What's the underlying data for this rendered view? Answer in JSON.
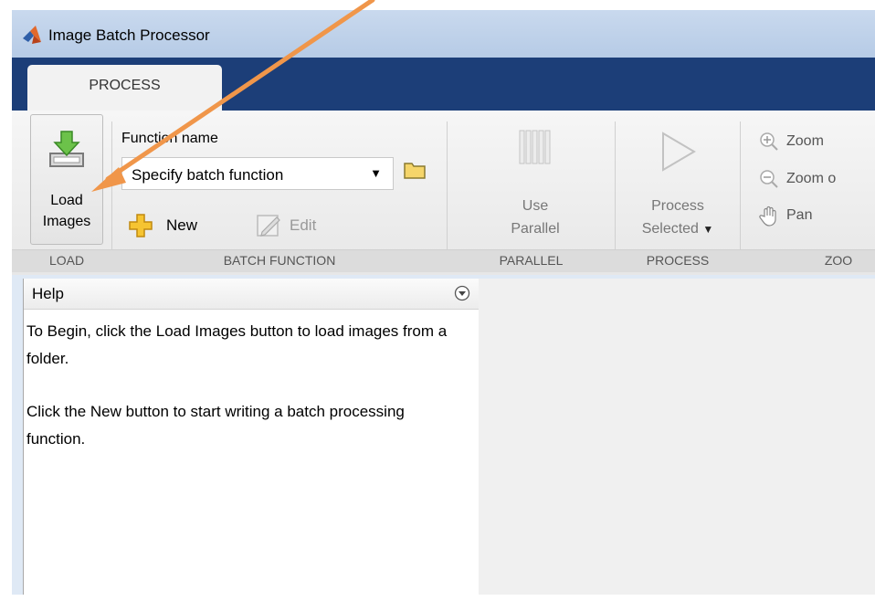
{
  "window": {
    "title": "Image Batch Processor"
  },
  "tabs": [
    {
      "label": "PROCESS"
    }
  ],
  "ribbon": {
    "load": {
      "button_label_line1": "Load",
      "button_label_line2": "Images",
      "section": "LOAD"
    },
    "batch_function": {
      "field_label": "Function name",
      "selected_value": "Specify batch function",
      "new_label": "New",
      "edit_label": "Edit",
      "section": "BATCH FUNCTION"
    },
    "parallel": {
      "label_line1": "Use",
      "label_line2": "Parallel",
      "section": "PARALLEL"
    },
    "process": {
      "label_line1": "Process",
      "label_line2": "Selected",
      "section": "PROCESS"
    },
    "zoom": {
      "zoom_in_label": "Zoom",
      "zoom_out_label": "Zoom o",
      "pan_label": "Pan",
      "section": "ZOO"
    }
  },
  "help": {
    "title": "Help",
    "paragraph1": "To Begin, click the Load Images button to load images from a folder.",
    "paragraph2": "Click the New button to start writing a batch processing function."
  },
  "colors": {
    "accent_tabbar": "#1c3e78",
    "annotation_arrow": "#f0964a"
  }
}
